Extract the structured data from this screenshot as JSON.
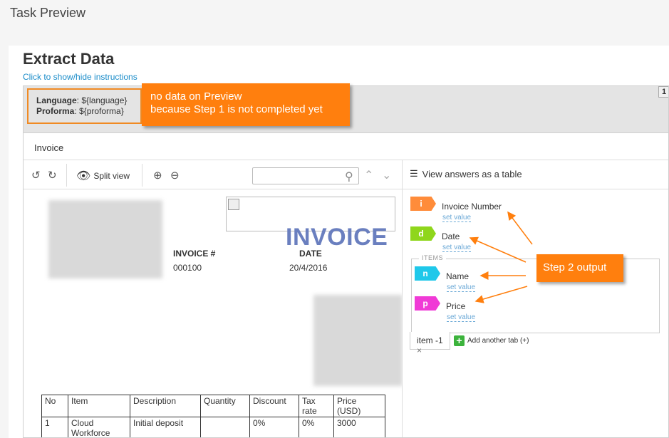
{
  "header": {
    "title": "Task Preview"
  },
  "card": {
    "title": "Extract Data",
    "instructions_link": "Click to show/hide instructions"
  },
  "meta": {
    "language_label": "Language",
    "language_value": ": ${language}",
    "proforma_label": "Proforma",
    "proforma_value": ": ${proforma}",
    "page_number": "1"
  },
  "notes": {
    "note1_line1": "no data on Preview",
    "note1_line2": "because Step 1 is not completed yet",
    "note2": "Step 2 output"
  },
  "doc_tab": "Invoice",
  "toolbar": {
    "undo_icon": "↺",
    "redo_icon": "↻",
    "split_view_label": "Split view",
    "eye_icon": "👁",
    "zoom_in_icon": "⊕",
    "zoom_out_icon": "⊖",
    "search_icon": "⚲",
    "up_icon": "⌃",
    "down_icon": "⌄"
  },
  "right_header": {
    "table_icon": "☰",
    "label": "View answers as a table"
  },
  "document": {
    "invoice_word": "INVOICE",
    "invoice_no_label": "INVOICE #",
    "invoice_no_value": "000100",
    "date_label": "DATE",
    "date_value": "20/4/2016",
    "table": {
      "headers": [
        "No",
        "Item",
        "Description",
        "Quantity",
        "Discount",
        "Tax rate",
        "Price (USD)"
      ],
      "rows": [
        [
          "1",
          "Cloud Workforce",
          "Initial deposit",
          "",
          "0%",
          "0%",
          "3000"
        ]
      ]
    }
  },
  "fields": {
    "invoice_number": {
      "tag": "i",
      "label": "Invoice Number",
      "set_value": "set value",
      "color": "#ff8c3a"
    },
    "date": {
      "tag": "d",
      "label": "Date",
      "set_value": "set value",
      "color": "#8fd61c"
    },
    "items_legend": "ITEMS",
    "name": {
      "tag": "n",
      "label": "Name",
      "set_value": "set value",
      "color": "#1fc8ea"
    },
    "price": {
      "tag": "p",
      "label": "Price",
      "set_value": "set value",
      "color": "#f03ad6"
    }
  },
  "item_tab": {
    "label": "item -1",
    "close": "×"
  },
  "add_tab": {
    "plus": "+",
    "label": "Add another tab (+)"
  }
}
